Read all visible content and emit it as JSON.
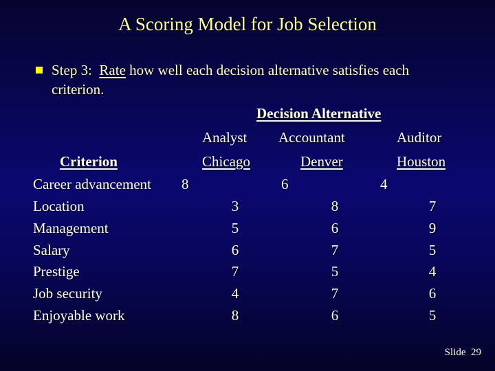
{
  "slide": {
    "title": "A Scoring Model for Job Selection",
    "bullet": {
      "icon": "square-bullet-icon",
      "prefix": "Step 3:  ",
      "emphasis": "Rate",
      "rest_line1": " how well each decision alternative satisfies each",
      "rest_line2": "criterion."
    },
    "table": {
      "group_header": "Decision Alternative",
      "criterion_header": "Criterion",
      "alternatives": [
        {
          "role": "Analyst",
          "city": "Chicago"
        },
        {
          "role": "Accountant",
          "city": "Denver"
        },
        {
          "role": "Auditor",
          "city": "Houston"
        }
      ],
      "rows": [
        {
          "criterion": "Career advancement",
          "scores": [
            "8",
            "6",
            "4"
          ]
        },
        {
          "criterion": "Location",
          "scores": [
            "3",
            "8",
            "7"
          ]
        },
        {
          "criterion": "Management",
          "scores": [
            "5",
            "6",
            "9"
          ]
        },
        {
          "criterion": "Salary",
          "scores": [
            "6",
            "7",
            "5"
          ]
        },
        {
          "criterion": "Prestige",
          "scores": [
            "7",
            "5",
            "4"
          ]
        },
        {
          "criterion": "Job security",
          "scores": [
            "4",
            "7",
            "6"
          ]
        },
        {
          "criterion": "Enjoyable work",
          "scores": [
            "8",
            "6",
            "5"
          ]
        }
      ]
    },
    "footer": {
      "slide_label": "Slide",
      "slide_number": "29"
    },
    "colors": {
      "title": "#ffff99",
      "bullet": "#ffff00",
      "body": "#ffffcc",
      "table_text": "#ffffff"
    }
  }
}
